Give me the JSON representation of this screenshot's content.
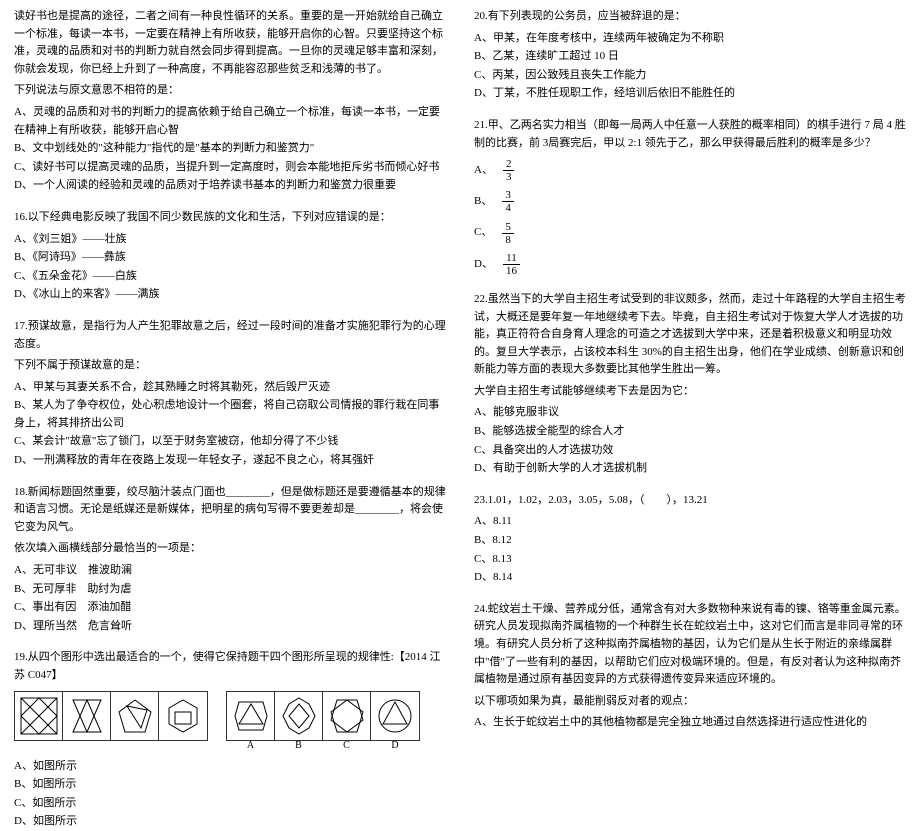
{
  "left": {
    "intro_p1": "读好书也是提高的途径，二者之间有一种良性循环的关系。重要的是一开始就给自己确立一个标准，每读一本书，一定要在精神上有所收获，能够开启你的心智。只要坚持这个标准，灵魂的品质和对书的判断力就自然会同步得到提高。一旦你的灵魂足够丰富和深刻，你就会发现，你已经上升到了一种高度，不再能容忍那些贫乏和浅薄的书了。",
    "intro_p2": "下列说法与原文意思不相符的是：",
    "intro_A": "A、灵魂的品质和对书的判断力的提高依赖于给自己确立一个标准，每读一本书，一定要在精神上有所收获，能够开启心智",
    "intro_B": "B、文中划线处的\"这种能力\"指代的是\"基本的判断力和鉴赏力\"",
    "intro_C": "C、读好书可以提高灵魂的品质，当提升到一定高度时，则会本能地拒斥劣书而倾心好书",
    "intro_D": "D、一个人阅读的经验和灵魂的品质对于培养读书基本的判断力和鉴赏力很重要",
    "q16_stem": "16.以下经典电影反映了我国不同少数民族的文化和生活，下列对应错误的是：",
    "q16_A": "A、《刘三姐》——壮族",
    "q16_B": "B、《阿诗玛》——彝族",
    "q16_C": "C、《五朵金花》——白族",
    "q16_D": "D、《冰山上的来客》——满族",
    "q17_stem1": "17.预谋故意，是指行为人产生犯罪故意之后，经过一段时间的准备才实施犯罪行为的心理态度。",
    "q17_stem2": "下列不属于预谋故意的是：",
    "q17_A": "A、甲某与其妻关系不合，趁其熟睡之时将其勒死，然后毁尸灭迹",
    "q17_B": "B、某人为了争夺权位，处心积虑地设计一个圈套，将自己窃取公司情报的罪行栽在同事身上，将其排挤出公司",
    "q17_C": "C、某会计\"故意\"忘了锁门，以至于财务室被窃，他却分得了不少钱",
    "q17_D": "D、一刑满释放的青年在夜路上发现一年轻女子，遂起不良之心，将其强奸",
    "q18_stem1": "18.新闻标题固然重要，绞尽脑汁装点门面也________，但是做标题还是要遵循基本的规律和语言习惯。无论是纸媒还是新媒体，把明星的病句写得不要更差却是________，将会使它变为风气。",
    "q18_stem2": "依次填入画横线部分最恰当的一项是：",
    "q18_A": "A、无可非议　推波助澜",
    "q18_B": "B、无可厚非　助纣为虐",
    "q18_C": "C、事出有因　添油加醋",
    "q18_D": "D、理所当然　危言耸听",
    "q19_stem": "19.从四个图形中选出最适合的一个，使得它保持题干四个图形所呈现的规律性:【2014 江苏 C047】",
    "q19_A": "A、如图所示",
    "q19_B": "B、如图所示",
    "q19_C": "C、如图所示",
    "q19_D": "D、如图所示",
    "labels": {
      "A": "A",
      "B": "B",
      "C": "C",
      "D": "D"
    }
  },
  "right": {
    "q20_stem": "20.有下列表现的公务员，应当被辞退的是：",
    "q20_A": "A、甲某，在年度考核中，连续两年被确定为不称职",
    "q20_B": "B、乙某，连续旷工超过 10 日",
    "q20_C": "C、丙某，因公致残且丧失工作能力",
    "q20_D": "D、丁某，不胜任现职工作，经培训后依旧不能胜任的",
    "q21_stem": "21.甲、乙两名实力相当（即每一局两人中任意一人获胜的概率相同）的棋手进行 7 局 4 胜制的比赛，前 3局赛完后，甲以 2:1 领先于乙，那么甲获得最后胜利的概率是多少？",
    "q21_fracs": [
      {
        "lab": "A、",
        "num": "2",
        "den": "3"
      },
      {
        "lab": "B、",
        "num": "3",
        "den": "4"
      },
      {
        "lab": "C、",
        "num": "5",
        "den": "8"
      },
      {
        "lab": "D、",
        "num": "11",
        "den": "16"
      }
    ],
    "q22_p1": "22.虽然当下的大学自主招生考试受到的非议颇多，然而，走过十年路程的大学自主招生考试，大概还是要年复一年地继续考下去。毕竟，自主招生考试对于恢复大学人才选拔的功能，真正符符合自身育人理念的可造之才选拔到大学中来，还是着积极意义和明显功效的。复旦大学表示，占该校本科生 30%的自主招生出身，他们在学业成绩、创新意识和创新能力等方面的表现大多数要比其他学生胜出一筹。",
    "q22_p2": "大学自主招生考试能够继续考下去是因为它：",
    "q22_A": "A、能够克服非议",
    "q22_B": "B、能够选拔全能型的综合人才",
    "q22_C": "C、具备突出的人才选拔功效",
    "q22_D": "D、有助于创新大学的人才选拔机制",
    "q23_stem": "23.1.01，1.02，2.03，3.05，5.08，（　　），13.21",
    "q23_A": "A、8.11",
    "q23_B": "B、8.12",
    "q23_C": "C、8.13",
    "q23_D": "D、8.14",
    "q24_p1": "24.蛇纹岩土干燥、营养成分低，通常含有对大多数物种来说有毒的镍、铬等重金属元素。研究人员发现拟南芥属植物的一个种群生长在蛇纹岩土中，这对它们而言是非同寻常的环境。有研究人员分析了这种拟南芥属植物的基因，认为它们是从生长于附近的亲缘属群中\"借\"了一些有利的基因，以帮助它们应对极端环境的。但是，有反对者认为这种拟南芥属植物是通过原有基因变异的方式获得遗传变异来适应环境的。",
    "q24_p2": "以下哪项如果为真，最能削弱反对者的观点：",
    "q24_A": "A、生长于蛇纹岩土中的其他植物都是完全独立地通过自然选择进行适应性进化的"
  }
}
